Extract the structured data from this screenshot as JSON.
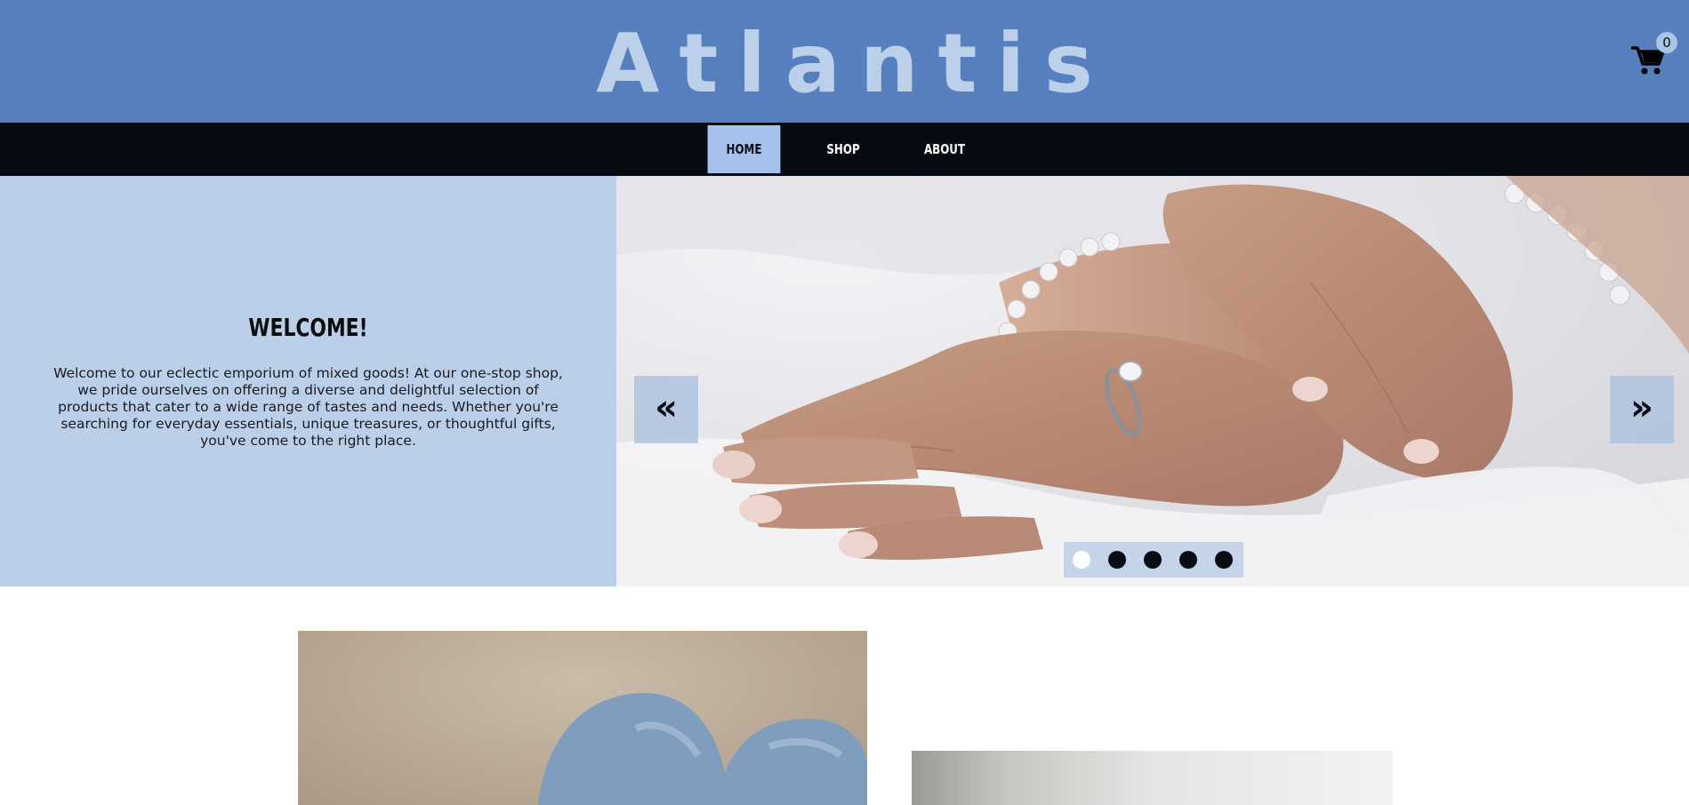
{
  "header": {
    "logo_text": "Atlantis",
    "cart_count": "0",
    "cart_icon": "shopping-cart-icon",
    "background": "#567fbe"
  },
  "nav": {
    "items": [
      {
        "label": "HOME",
        "active": true
      },
      {
        "label": "SHOP",
        "active": false
      },
      {
        "label": "ABOUT",
        "active": false
      }
    ]
  },
  "hero": {
    "title": "WELCOME!",
    "text": "Welcome to our eclectic emporium of mixed goods! At our one-stop shop, we pride ourselves on offering a diverse and delightful selection of products that cater to a wide range of tastes and needs. Whether you're searching for everyday essentials, unique treasures, or thoughtful gifts, you've come to the right place.",
    "prev_label": "«",
    "next_label": "»",
    "slide_count": 5,
    "active_slide": 1
  },
  "colors": {
    "nav_bg": "#060a12",
    "nav_active": "#a4c2ea",
    "hero_panel": "#bbcfe8"
  }
}
